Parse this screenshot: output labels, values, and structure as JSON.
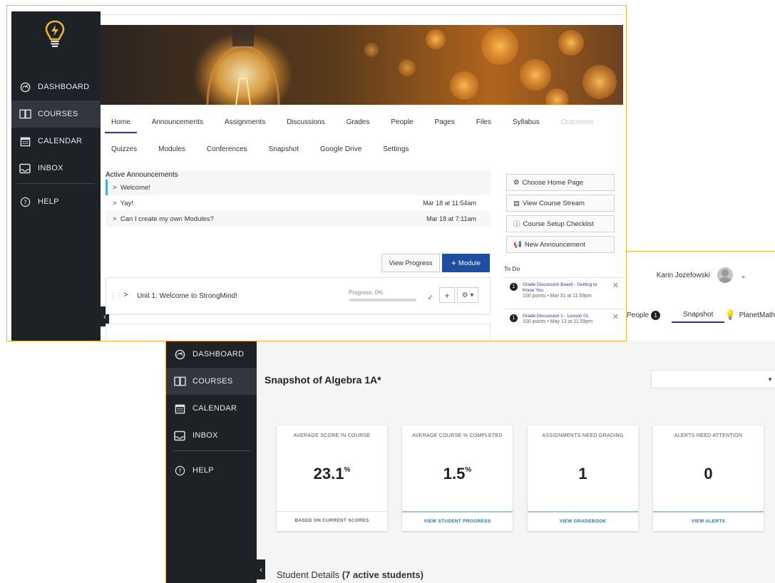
{
  "back": {
    "user": {
      "name": "Karin Jozefowski"
    },
    "tabs": {
      "people": "People",
      "people_badge": "1",
      "snapshot": "Snapshot",
      "planetmath": "PlanetMath"
    },
    "nav": [
      {
        "label": "DASHBOARD",
        "icon": "dashboard-icon"
      },
      {
        "label": "COURSES",
        "icon": "book-icon"
      },
      {
        "label": "CALENDAR",
        "icon": "calendar-icon"
      },
      {
        "label": "INBOX",
        "icon": "inbox-icon"
      },
      {
        "label": "HELP",
        "icon": "help-icon"
      }
    ],
    "title": "Snapshot of Algebra 1A*",
    "cards": [
      {
        "label": "AVERAGE SCORE IN COURSE",
        "value": "23.1",
        "unit": "%",
        "footer": "BASED ON CURRENT SCORES"
      },
      {
        "label": "AVERAGE COURSE % COMPLETED",
        "value": "1.5",
        "unit": "%",
        "footer": "VIEW STUDENT PROGRESS"
      },
      {
        "label": "ASSIGNMENTS NEED GRADING",
        "value": "1",
        "unit": "",
        "footer": "VIEW GRADEBOOK"
      },
      {
        "label": "ALERTS NEED ATTENTION",
        "value": "0",
        "unit": "",
        "footer": "VIEW ALERTS"
      }
    ],
    "student_details": {
      "label": "Student Details",
      "count": "(7 active students)"
    }
  },
  "front": {
    "nav": [
      {
        "label": "DASHBOARD",
        "icon": "dashboard-icon"
      },
      {
        "label": "COURSES",
        "icon": "book-icon"
      },
      {
        "label": "CALENDAR",
        "icon": "calendar-icon"
      },
      {
        "label": "INBOX",
        "icon": "inbox-icon"
      },
      {
        "label": "HELP",
        "icon": "help-icon"
      }
    ],
    "tabs_row1": [
      "Home",
      "Announcements",
      "Assignments",
      "Discussions",
      "Grades",
      "People",
      "Pages",
      "Files",
      "Syllabus",
      "Outcomes"
    ],
    "tabs_row2": [
      "Quizzes",
      "Modules",
      "Conferences",
      "Snapshot",
      "Google Drive",
      "Settings"
    ],
    "announcements": {
      "title": "Active Announcements",
      "items": [
        {
          "title": "Welcome!",
          "date": ""
        },
        {
          "title": "Yay!",
          "date": "Mar 18 at 11:54am"
        },
        {
          "title": "Can I create my own Modules?",
          "date": "Mar 18 at 7:11am"
        }
      ]
    },
    "side_buttons": [
      "Choose Home Page",
      "View Course Stream",
      "Course Setup Checklist",
      "New Announcement"
    ],
    "buttons": {
      "view_progress": "View Progress",
      "module": "Module"
    },
    "module": {
      "name": "Unit 1: Welcome to StrongMind!",
      "progress_label": "Progress: 0%",
      "progress": 0
    },
    "todo": {
      "title": "To Do",
      "items": [
        {
          "badge": "1",
          "title": "Grade Discussion Board - Getting to Know You",
          "meta": "100 points • Mar 31 at 11:59pm"
        },
        {
          "badge": "1",
          "title": "Grade Discussion 1 - Lesson 01",
          "meta": "100 points • May 13 at 11:59pm"
        }
      ]
    }
  },
  "colors": {
    "accent": "#3b2bb2",
    "primary_button": "#1f4ea1",
    "sidebar": "#1e2126",
    "frame": "#f1b232",
    "announcement_marker": "#3cb6c8"
  }
}
